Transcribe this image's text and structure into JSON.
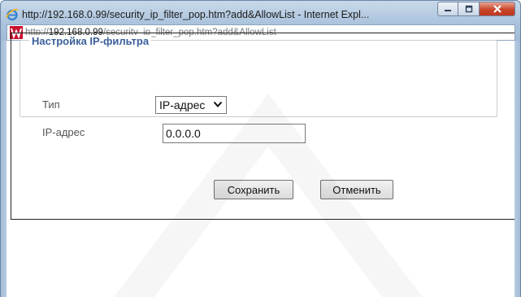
{
  "window": {
    "title": "http://192.168.0.99/security_ip_filter_pop.htm?add&AllowList - Internet Expl...",
    "address_host": "192.168.0.99",
    "address_prefix": "http://",
    "address_path": "/security_ip_filter_pop.htm?add&AllowList"
  },
  "form": {
    "legend": "Настройка IP-фильтра",
    "type_label": "Тип",
    "type_value": "IP-адрес",
    "ip_label": "IP-адрес",
    "ip_value": "0.0.0.0"
  },
  "buttons": {
    "save": "Сохранить",
    "cancel": "Отменить"
  }
}
